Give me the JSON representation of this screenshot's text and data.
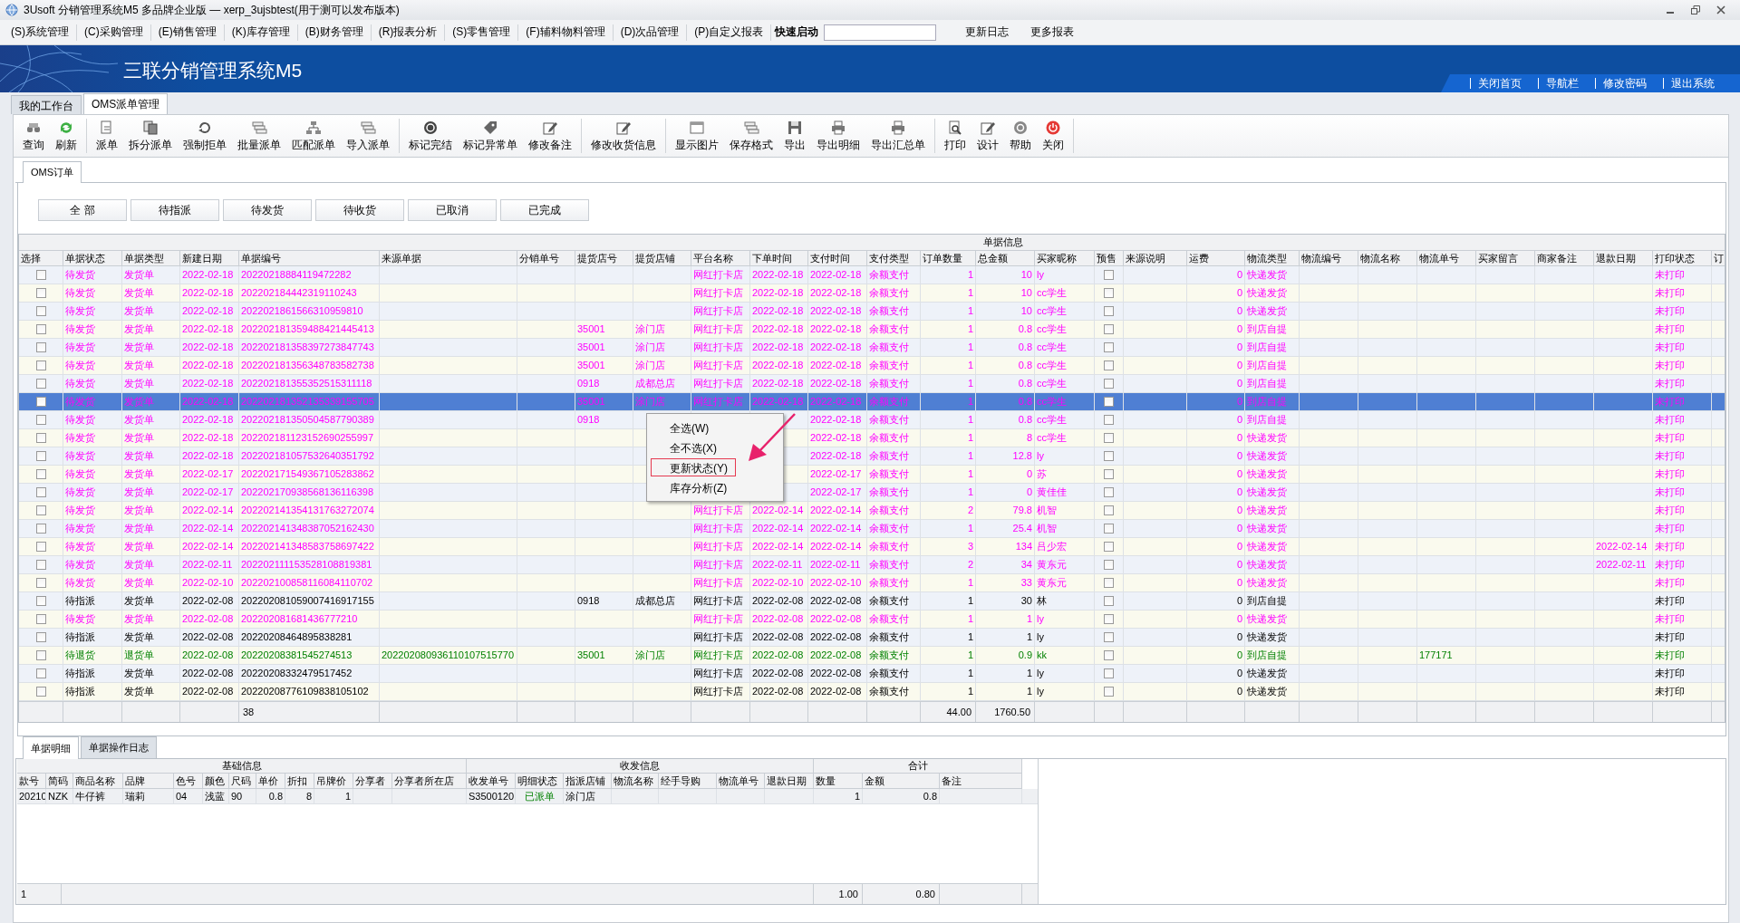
{
  "window": {
    "title": "3Usoft 分销管理系统M5 多品牌企业版 — xerp_3ujsbtest(用于测可以发布版本)"
  },
  "menu": [
    {
      "label": "(S)系统管理"
    },
    {
      "label": "(C)采购管理"
    },
    {
      "label": "(E)销售管理"
    },
    {
      "label": "(K)库存管理"
    },
    {
      "label": "(B)财务管理"
    },
    {
      "label": "(R)报表分析"
    },
    {
      "label": "(S)零售管理"
    },
    {
      "label": "(F)辅料物料管理"
    },
    {
      "label": "(D)次品管理"
    },
    {
      "label": "(P)自定义报表"
    }
  ],
  "quick_launch": {
    "label": "快速启动"
  },
  "menu_extra": [
    {
      "label": "更新日志"
    },
    {
      "label": "更多报表"
    }
  ],
  "banner": {
    "title": "三联分销管理系统M5",
    "links": [
      {
        "label": "关闭首页"
      },
      {
        "label": "导航栏"
      },
      {
        "label": "修改密码"
      },
      {
        "label": "退出系统"
      }
    ]
  },
  "tabs": [
    {
      "label": "我的工作台",
      "selected": false
    },
    {
      "label": "OMS派单管理",
      "selected": true
    }
  ],
  "toolbar": [
    [
      {
        "label": "查询",
        "kind": "binoculars"
      },
      {
        "label": "刷新",
        "kind": "refresh"
      }
    ],
    [
      {
        "label": "派单",
        "kind": "document"
      },
      {
        "label": "拆分派单",
        "kind": "documents"
      },
      {
        "label": "强制拒单",
        "kind": "cycle"
      },
      {
        "label": "批量派单",
        "kind": "stack"
      },
      {
        "label": "匹配派单",
        "kind": "hierarchy"
      },
      {
        "label": "导入派单",
        "kind": "stack"
      }
    ],
    [
      {
        "label": "标记完结",
        "kind": "record"
      },
      {
        "label": "标记异常单",
        "kind": "tag"
      },
      {
        "label": "修改备注",
        "kind": "pencil"
      }
    ],
    [
      {
        "label": "修改收货信息",
        "kind": "pencil"
      }
    ],
    [
      {
        "label": "显示图片",
        "kind": "window"
      },
      {
        "label": "保存格式",
        "kind": "stack"
      },
      {
        "label": "导出",
        "kind": "floppy"
      },
      {
        "label": "导出明细",
        "kind": "printer"
      },
      {
        "label": "导出汇总单",
        "kind": "printer"
      }
    ],
    [
      {
        "label": "打印",
        "kind": "preview"
      },
      {
        "label": "设计",
        "kind": "pencil"
      },
      {
        "label": "帮助",
        "kind": "help"
      },
      {
        "label": "关闭",
        "kind": "power"
      }
    ]
  ],
  "inner_tabs": [
    {
      "label": "OMS订单",
      "selected": true
    }
  ],
  "filters": [
    {
      "label": "全 部",
      "selected": false
    },
    {
      "label": "待指派",
      "selected": false
    },
    {
      "label": "待发货",
      "selected": false
    },
    {
      "label": "待收货",
      "selected": false
    },
    {
      "label": "已取消",
      "selected": false
    },
    {
      "label": "已完成",
      "selected": false
    }
  ],
  "table": {
    "group_header": "单据信息",
    "columns": [
      {
        "label": "选择",
        "kind": "check"
      },
      {
        "label": "单据状态",
        "kind": "text"
      },
      {
        "label": "单据类型",
        "kind": "text"
      },
      {
        "label": "新建日期",
        "kind": "text"
      },
      {
        "label": "单据编号",
        "kind": "text"
      },
      {
        "label": "来源单据",
        "kind": "text"
      },
      {
        "label": "分销单号",
        "kind": "text"
      },
      {
        "label": "提货店号",
        "kind": "text"
      },
      {
        "label": "提货店铺",
        "kind": "text"
      },
      {
        "label": "平台名称",
        "kind": "text"
      },
      {
        "label": "下单时间",
        "kind": "text"
      },
      {
        "label": "支付时间",
        "kind": "text"
      },
      {
        "label": "支付类型",
        "kind": "text"
      },
      {
        "label": "订单数量",
        "kind": "num"
      },
      {
        "label": "总金额",
        "kind": "num"
      },
      {
        "label": "买家昵称",
        "kind": "text"
      },
      {
        "label": "预售",
        "kind": "check"
      },
      {
        "label": "来源说明",
        "kind": "text"
      },
      {
        "label": "运费",
        "kind": "num"
      },
      {
        "label": "物流类型",
        "kind": "text"
      },
      {
        "label": "物流编号",
        "kind": "text"
      },
      {
        "label": "物流名称",
        "kind": "text"
      },
      {
        "label": "物流单号",
        "kind": "text"
      },
      {
        "label": "买家留言",
        "kind": "text"
      },
      {
        "label": "商家备注",
        "kind": "text"
      },
      {
        "label": "退款日期",
        "kind": "text"
      },
      {
        "label": "打印状态",
        "kind": "text"
      },
      {
        "label": "订",
        "kind": "text"
      }
    ],
    "rows": [
      {
        "selected": false,
        "kind": "ship",
        "checked": false,
        "presale": false,
        "status": "待发货",
        "type": "发货单",
        "created": "2022-02-18",
        "number": "20220218884119472282",
        "platform": "网红打卡店",
        "ordered": "2022-02-18",
        "paid": "2022-02-18",
        "pay_type": "余额支付",
        "qty": "1",
        "amount": "10",
        "buyer": "ly",
        "freight": "0",
        "logistics": "快递发货",
        "print": "未打印"
      },
      {
        "selected": false,
        "kind": "ship",
        "checked": false,
        "presale": false,
        "status": "待发货",
        "type": "发货单",
        "created": "2022-02-18",
        "number": "202202184442319110243",
        "platform": "网红打卡店",
        "ordered": "2022-02-18",
        "paid": "2022-02-18",
        "pay_type": "余额支付",
        "qty": "1",
        "amount": "10",
        "buyer": "cc学生",
        "freight": "0",
        "logistics": "快递发货",
        "print": "未打印"
      },
      {
        "selected": false,
        "kind": "ship",
        "checked": false,
        "presale": false,
        "status": "待发货",
        "type": "发货单",
        "created": "2022-02-18",
        "number": "2022021861566310959810",
        "platform": "网红打卡店",
        "ordered": "2022-02-18",
        "paid": "2022-02-18",
        "pay_type": "余额支付",
        "qty": "1",
        "amount": "10",
        "buyer": "cc学生",
        "freight": "0",
        "logistics": "快递发货",
        "print": "未打印"
      },
      {
        "selected": false,
        "kind": "ship",
        "checked": false,
        "presale": false,
        "status": "待发货",
        "type": "发货单",
        "created": "2022-02-18",
        "number": "202202181359488421445413",
        "store_no": "35001",
        "store": "涂门店",
        "platform": "网红打卡店",
        "ordered": "2022-02-18",
        "paid": "2022-02-18",
        "pay_type": "余额支付",
        "qty": "1",
        "amount": "0.8",
        "buyer": "cc学生",
        "freight": "0",
        "logistics": "到店自提",
        "print": "未打印"
      },
      {
        "selected": false,
        "kind": "ship",
        "checked": false,
        "presale": false,
        "status": "待发货",
        "type": "发货单",
        "created": "2022-02-18",
        "number": "202202181358397273847743",
        "store_no": "35001",
        "store": "涂门店",
        "platform": "网红打卡店",
        "ordered": "2022-02-18",
        "paid": "2022-02-18",
        "pay_type": "余额支付",
        "qty": "1",
        "amount": "0.8",
        "buyer": "cc学生",
        "freight": "0",
        "logistics": "到店自提",
        "print": "未打印"
      },
      {
        "selected": false,
        "kind": "ship",
        "checked": false,
        "presale": false,
        "status": "待发货",
        "type": "发货单",
        "created": "2022-02-18",
        "number": "202202181356348783582738",
        "store_no": "35001",
        "store": "涂门店",
        "platform": "网红打卡店",
        "ordered": "2022-02-18",
        "paid": "2022-02-18",
        "pay_type": "余额支付",
        "qty": "1",
        "amount": "0.8",
        "buyer": "cc学生",
        "freight": "0",
        "logistics": "到店自提",
        "print": "未打印"
      },
      {
        "selected": false,
        "kind": "ship",
        "checked": false,
        "presale": false,
        "status": "待发货",
        "type": "发货单",
        "created": "2022-02-18",
        "number": "202202181355352515311118",
        "store_no": "0918",
        "store": "成都总店",
        "platform": "网红打卡店",
        "ordered": "2022-02-18",
        "paid": "2022-02-18",
        "pay_type": "余额支付",
        "qty": "1",
        "amount": "0.8",
        "buyer": "cc学生",
        "freight": "0",
        "logistics": "到店自提",
        "print": "未打印"
      },
      {
        "selected": true,
        "kind": "ship",
        "checked": false,
        "presale": false,
        "status": "待发货",
        "type": "发货单",
        "created": "2022-02-18",
        "number": "202202181352135339155705",
        "store_no": "35001",
        "store": "涂门店",
        "platform": "网红打卡店",
        "ordered": "2022-02-18",
        "paid": "2022-02-18",
        "pay_type": "余额支付",
        "qty": "1",
        "amount": "0.8",
        "buyer": "cc学生",
        "freight": "0",
        "logistics": "到店自提",
        "print": "未打印"
      },
      {
        "selected": false,
        "kind": "ship",
        "checked": false,
        "presale": false,
        "status": "待发货",
        "type": "发货单",
        "created": "2022-02-18",
        "number": "202202181350504587790389",
        "store_no": "0918",
        "paid": "2022-02-18",
        "pay_type": "余额支付",
        "qty": "1",
        "amount": "0.8",
        "buyer": "cc学生",
        "freight": "0",
        "logistics": "到店自提",
        "print": "未打印"
      },
      {
        "selected": false,
        "kind": "ship",
        "checked": false,
        "presale": false,
        "status": "待发货",
        "type": "发货单",
        "created": "2022-02-18",
        "number": "202202181123152690255997",
        "paid": "2022-02-18",
        "pay_type": "余额支付",
        "qty": "1",
        "amount": "8",
        "buyer": "cc学生",
        "freight": "0",
        "logistics": "快递发货",
        "print": "未打印"
      },
      {
        "selected": false,
        "kind": "ship",
        "checked": false,
        "presale": false,
        "status": "待发货",
        "type": "发货单",
        "created": "2022-02-18",
        "number": "202202181057532640351792",
        "paid": "2022-02-18",
        "pay_type": "余额支付",
        "qty": "1",
        "amount": "12.8",
        "buyer": "ly",
        "freight": "0",
        "logistics": "快递发货",
        "print": "未打印"
      },
      {
        "selected": false,
        "kind": "ship",
        "checked": false,
        "presale": false,
        "status": "待发货",
        "type": "发货单",
        "created": "2022-02-17",
        "number": "202202171549367105283862",
        "paid": "2022-02-17",
        "pay_type": "余额支付",
        "qty": "1",
        "amount": "0",
        "buyer": "苏",
        "freight": "0",
        "logistics": "快递发货",
        "print": "未打印"
      },
      {
        "selected": false,
        "kind": "ship",
        "checked": false,
        "presale": false,
        "status": "待发货",
        "type": "发货单",
        "created": "2022-02-17",
        "number": "202202170938568136116398",
        "paid": "2022-02-17",
        "pay_type": "余额支付",
        "qty": "1",
        "amount": "0",
        "buyer": "黄佳佳",
        "freight": "0",
        "logistics": "快递发货",
        "print": "未打印"
      },
      {
        "selected": false,
        "kind": "ship",
        "checked": false,
        "presale": false,
        "status": "待发货",
        "type": "发货单",
        "created": "2022-02-14",
        "number": "202202141354131763272074",
        "platform": "网红打卡店",
        "ordered": "2022-02-14",
        "paid": "2022-02-14",
        "pay_type": "余额支付",
        "qty": "2",
        "amount": "79.8",
        "buyer": "机智",
        "freight": "0",
        "logistics": "快递发货",
        "print": "未打印"
      },
      {
        "selected": false,
        "kind": "ship",
        "checked": false,
        "presale": false,
        "status": "待发货",
        "type": "发货单",
        "created": "2022-02-14",
        "number": "202202141348387052162430",
        "platform": "网红打卡店",
        "ordered": "2022-02-14",
        "paid": "2022-02-14",
        "pay_type": "余额支付",
        "qty": "1",
        "amount": "25.4",
        "buyer": "机智",
        "freight": "0",
        "logistics": "快递发货",
        "print": "未打印"
      },
      {
        "selected": false,
        "kind": "ship",
        "checked": false,
        "presale": false,
        "status": "待发货",
        "type": "发货单",
        "created": "2022-02-14",
        "number": "202202141348583758697422",
        "platform": "网红打卡店",
        "ordered": "2022-02-14",
        "paid": "2022-02-14",
        "pay_type": "余额支付",
        "qty": "3",
        "amount": "134",
        "buyer": "吕少宏",
        "freight": "0",
        "logistics": "快递发货",
        "refund": "2022-02-14",
        "print": "未打印"
      },
      {
        "selected": false,
        "kind": "ship",
        "checked": false,
        "presale": false,
        "status": "待发货",
        "type": "发货单",
        "created": "2022-02-11",
        "number": "202202111153528108819381",
        "platform": "网红打卡店",
        "ordered": "2022-02-11",
        "paid": "2022-02-11",
        "pay_type": "余额支付",
        "qty": "2",
        "amount": "34",
        "buyer": "黄东元",
        "freight": "0",
        "logistics": "快递发货",
        "refund": "2022-02-11",
        "print": "未打印"
      },
      {
        "selected": false,
        "kind": "ship",
        "checked": false,
        "presale": false,
        "status": "待发货",
        "type": "发货单",
        "created": "2022-02-10",
        "number": "202202100858116084110702",
        "platform": "网红打卡店",
        "ordered": "2022-02-10",
        "paid": "2022-02-10",
        "pay_type": "余额支付",
        "qty": "1",
        "amount": "33",
        "buyer": "黄东元",
        "freight": "0",
        "logistics": "快递发货",
        "print": "未打印"
      },
      {
        "selected": false,
        "kind": "assign",
        "checked": false,
        "presale": false,
        "status": "待指派",
        "type": "发货单",
        "created": "2022-02-08",
        "number": "202202081059007416917155",
        "store_no": "0918",
        "store": "成都总店",
        "platform": "网红打卡店",
        "ordered": "2022-02-08",
        "paid": "2022-02-08",
        "pay_type": "余额支付",
        "qty": "1",
        "amount": "30",
        "buyer": "林",
        "freight": "0",
        "logistics": "到店自提",
        "print": "未打印"
      },
      {
        "selected": false,
        "kind": "ship",
        "checked": false,
        "presale": false,
        "status": "待发货",
        "type": "发货单",
        "created": "2022-02-08",
        "number": "202202081681436777210",
        "platform": "网红打卡店",
        "ordered": "2022-02-08",
        "paid": "2022-02-08",
        "pay_type": "余额支付",
        "qty": "1",
        "amount": "1",
        "buyer": "ly",
        "freight": "0",
        "logistics": "快递发货",
        "print": "未打印"
      },
      {
        "selected": false,
        "kind": "assign",
        "checked": false,
        "presale": false,
        "status": "待指派",
        "type": "发货单",
        "created": "2022-02-08",
        "number": "20220208464895838281",
        "platform": "网红打卡店",
        "ordered": "2022-02-08",
        "paid": "2022-02-08",
        "pay_type": "余额支付",
        "qty": "1",
        "amount": "1",
        "buyer": "ly",
        "freight": "0",
        "logistics": "快递发货",
        "print": "未打印"
      },
      {
        "selected": false,
        "kind": "return",
        "checked": false,
        "presale": false,
        "status": "待退货",
        "type": "退货单",
        "created": "2022-02-08",
        "number": "20220208381545274513",
        "source": "202202080936110107515770",
        "store_no": "35001",
        "store": "涂门店",
        "platform": "网红打卡店",
        "ordered": "2022-02-08",
        "paid": "2022-02-08",
        "pay_type": "余额支付",
        "qty": "1",
        "amount": "0.9",
        "buyer": "kk",
        "freight": "0",
        "logistics": "到店自提",
        "tracking": "177171",
        "print": "未打印"
      },
      {
        "selected": false,
        "kind": "assign",
        "checked": false,
        "presale": false,
        "status": "待指派",
        "type": "发货单",
        "created": "2022-02-08",
        "number": "20220208332479517452",
        "platform": "网红打卡店",
        "ordered": "2022-02-08",
        "paid": "2022-02-08",
        "pay_type": "余额支付",
        "qty": "1",
        "amount": "1",
        "buyer": "ly",
        "freight": "0",
        "logistics": "快递发货",
        "print": "未打印"
      },
      {
        "selected": false,
        "kind": "assign",
        "checked": false,
        "presale": false,
        "status": "待指派",
        "type": "发货单",
        "created": "2022-02-08",
        "number": "20220208776109838105102",
        "platform": "网红打卡店",
        "ordered": "2022-02-08",
        "paid": "2022-02-08",
        "pay_type": "余额支付",
        "qty": "1",
        "amount": "1",
        "buyer": "ly",
        "freight": "0",
        "logistics": "快递发货",
        "print": "未打印"
      }
    ],
    "summary": {
      "count": "38",
      "qty": "44.00",
      "amount": "1760.50"
    }
  },
  "context_menu": {
    "items": [
      {
        "label": "全选(W)",
        "selected": false
      },
      {
        "label": "全不选(X)",
        "selected": false
      },
      {
        "label": "更新状态(Y)",
        "selected": true
      },
      {
        "label": "库存分析(Z)",
        "selected": false
      }
    ]
  },
  "detail_tabs": [
    {
      "label": "单据明细",
      "selected": true
    },
    {
      "label": "单据操作日志",
      "selected": false
    }
  ],
  "detail": {
    "groups": [
      {
        "label": "基础信息",
        "columns": [
          "款号",
          "简码",
          "商品名称",
          "品牌",
          "色号",
          "颜色",
          "尺码",
          "单价",
          "折扣",
          "吊牌价",
          "分享者",
          "分享者所在店"
        ]
      },
      {
        "label": "收发信息",
        "columns": [
          "收发单号",
          "明细状态",
          "指派店铺",
          "物流名称",
          "经手导购",
          "物流单号",
          "退款日期"
        ]
      },
      {
        "label": "合计",
        "columns": [
          "数量",
          "金额",
          "备注"
        ]
      }
    ],
    "rows": [
      {
        "style_no": "20210",
        "code": "NZK",
        "name": "牛仔裤",
        "brand": "瑞莉",
        "color_no": "04",
        "color_name": "浅蓝",
        "size": "90",
        "price": "0.8",
        "discount": "8",
        "tag_price": "1",
        "doc_no": "S3500120",
        "status": "已派单",
        "store": "涂门店",
        "qty": "1",
        "amount": "0.8"
      }
    ],
    "footer": {
      "count": "1",
      "qty": "1.00",
      "amount": "0.80"
    }
  }
}
